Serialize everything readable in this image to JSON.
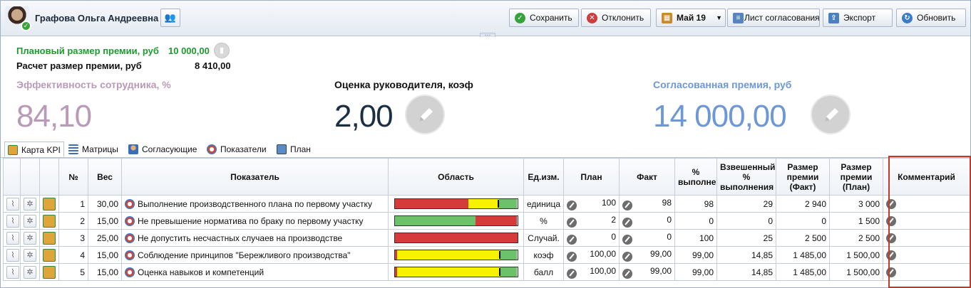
{
  "header": {
    "user_name": "Графова Ольга Андреевна",
    "buttons": {
      "save": "Сохранить",
      "reject": "Отклонить",
      "period": "Май 19",
      "approval_sheet": "Лист согласования",
      "export": "Экспорт",
      "refresh": "Обновить"
    }
  },
  "summary": {
    "plan_label": "Плановый размер премии, руб",
    "plan_value": "10 000,00",
    "calc_label": "Расчет размер премии, руб",
    "calc_value": "8 410,00",
    "efficiency_label": "Эффективность сотрудника, %",
    "efficiency_value": "84,10",
    "manager_label": "Оценка руководителя, коэф",
    "manager_value": "2,00",
    "agreed_label": "Согласованная премия, руб",
    "agreed_value": "14 000,00"
  },
  "colors": {
    "efficiency": "#b99ab7",
    "manager": "#1b2f44",
    "agreed": "#6d97d6",
    "plan": "#1f9b2e",
    "bar_red": "#d63b3b",
    "bar_yellow": "#f7f200",
    "bar_green": "#6cc16a"
  },
  "tabs": [
    "Карта KPI",
    "Матрицы",
    "Согласующие",
    "Показатели",
    "План"
  ],
  "table": {
    "headers": {
      "no": "№",
      "weight": "Вес",
      "indicator": "Показатель",
      "area": "Область",
      "unit": "Ед.изм.",
      "plan": "План",
      "fact": "Факт",
      "pct": "% выполнения",
      "weighted": "Взвешенный % выполнения",
      "bonus_fact": "Размер премии (Факт)",
      "bonus_plan": "Размер премии (План)",
      "comment": "Комментарий"
    },
    "rows": [
      {
        "no": "1",
        "weight": "30,00",
        "indicator": "Выполнение производственного плана по первому участку",
        "unit": "единица",
        "plan": "100",
        "fact": "98",
        "pct": "98",
        "weighted": "29",
        "bonus_fact": "2 940",
        "bonus_plan": "3 000",
        "bar": [
          0.6,
          0.25,
          0.15
        ],
        "marker": 0.84
      },
      {
        "no": "2",
        "weight": "15,00",
        "indicator": "Не превышение норматива по браку по первому участку",
        "unit": "%",
        "plan": "2",
        "fact": "0",
        "pct": "0",
        "weighted": "0",
        "bonus_fact": "0",
        "bonus_plan": "1 500",
        "bar": [
          0.0,
          0.0,
          0.66,
          0.34
        ],
        "marker": null
      },
      {
        "no": "3",
        "weight": "25,00",
        "indicator": "Не допустить несчастных случаев на производстве",
        "unit": "Случай.",
        "plan": "0",
        "fact": "0",
        "pct": "100",
        "weighted": "25",
        "bonus_fact": "2 500",
        "bonus_plan": "2 500",
        "bar": [
          1.0,
          0,
          0
        ],
        "marker": null
      },
      {
        "no": "4",
        "weight": "15,00",
        "indicator": "Соблюдение принципов \"Бережливого производства\"",
        "unit": "коэф",
        "plan": "100,00",
        "fact": "99,00",
        "pct": "99,00",
        "weighted": "14,85",
        "bonus_fact": "1 485,00",
        "bonus_plan": "1 500,00",
        "bar": [
          0.02,
          0.84,
          0.14
        ],
        "marker": 0.85
      },
      {
        "no": "5",
        "weight": "15,00",
        "indicator": "Оценка навыков и компетенций",
        "unit": "балл",
        "plan": "100,00",
        "fact": "99,00",
        "pct": "99,00",
        "weighted": "14,85",
        "bonus_fact": "1 485,00",
        "bonus_plan": "1 500,00",
        "bar": [
          0.02,
          0.84,
          0.14
        ],
        "marker": 0.85
      }
    ]
  }
}
